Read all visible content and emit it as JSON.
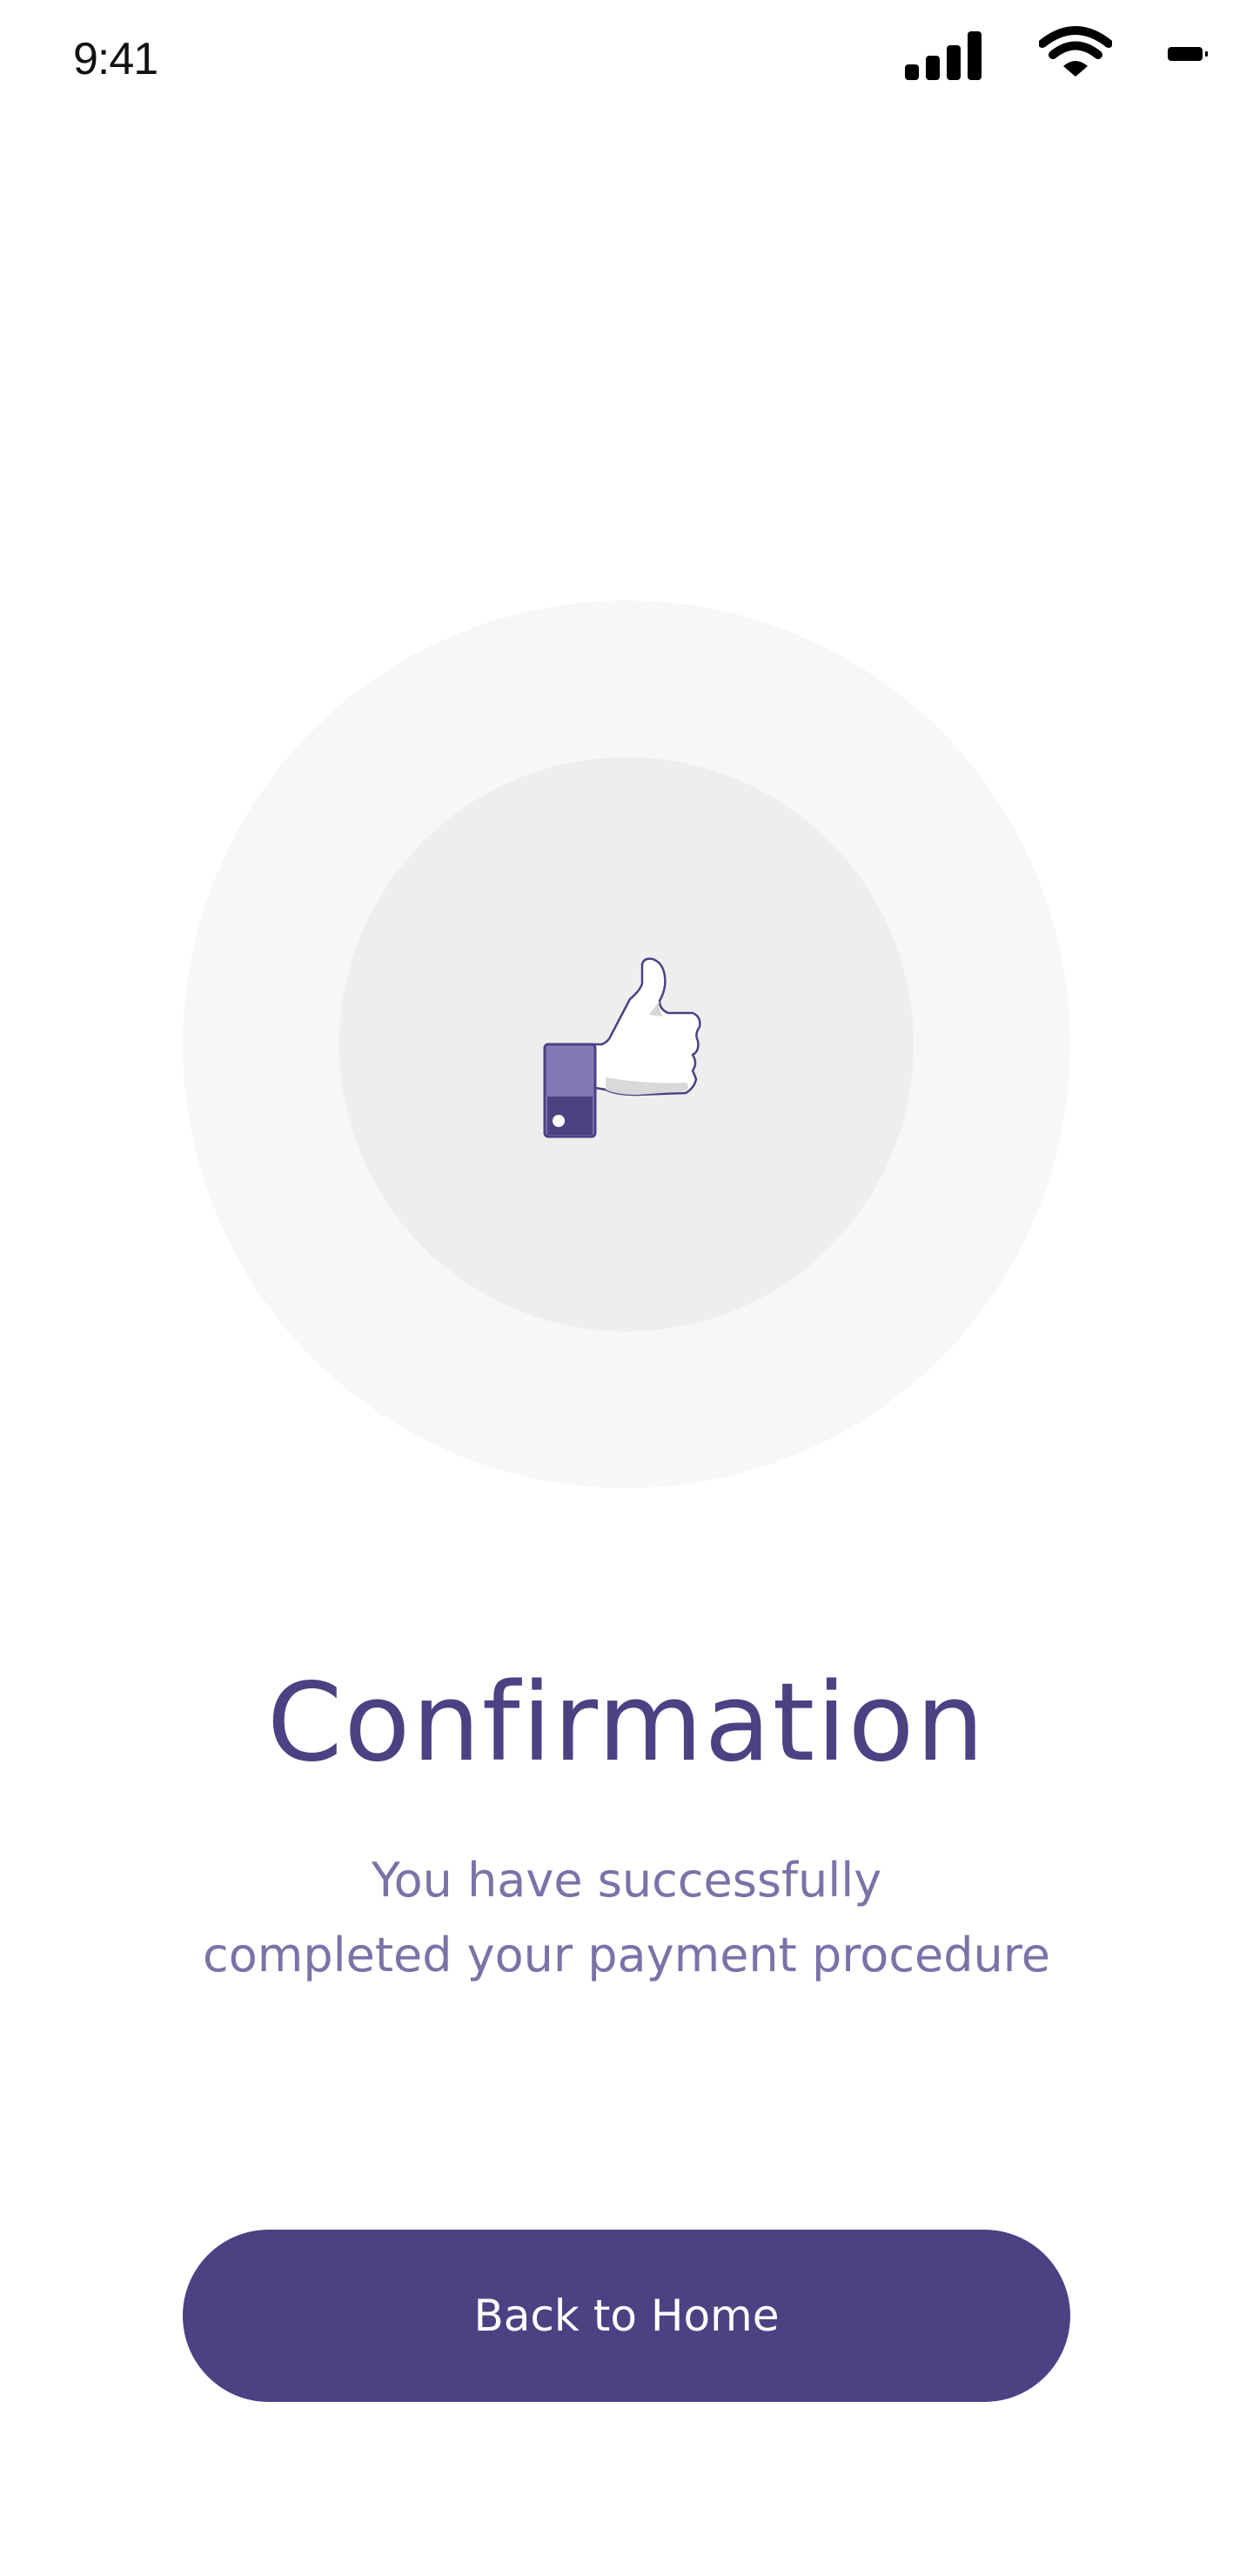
{
  "status_bar": {
    "time": "9:41",
    "icons": [
      "signal-icon",
      "wifi-icon",
      "battery-icon"
    ]
  },
  "illustration": {
    "icon": "thumbs-up-icon"
  },
  "content": {
    "title": "Confirmation",
    "subtitle_line_1": "You have successfully",
    "subtitle_line_2": "completed your payment procedure"
  },
  "actions": {
    "back_home_label": "Back to Home"
  },
  "colors": {
    "primary": "#4b4283",
    "subtitle": "#7a73a8",
    "outer_circle": "#f7f7f7",
    "inner_circle": "#eeeeee",
    "background": "#ffffff"
  }
}
